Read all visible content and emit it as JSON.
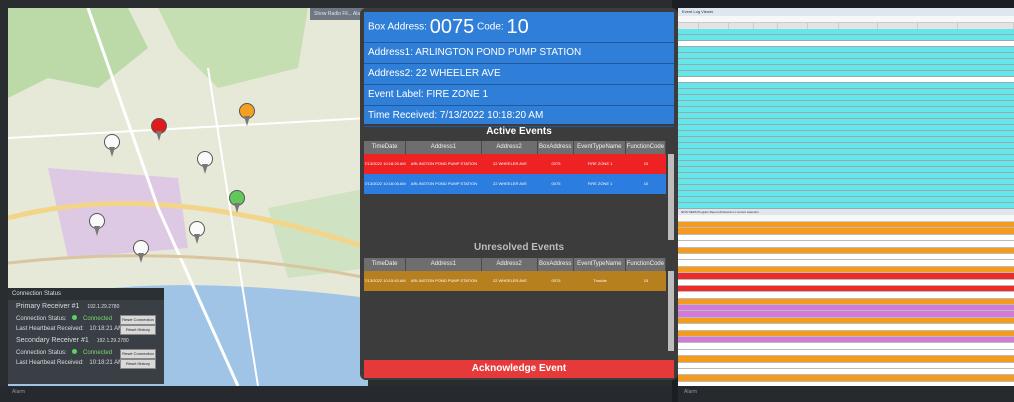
{
  "app": {
    "left_taskbar_label": "Alarm",
    "right_taskbar_label": "Alarm"
  },
  "map": {
    "header": "Show Radio Fil... Alarm"
  },
  "event": {
    "box_address_label": "Box Address:",
    "box_address": "0075",
    "code_label": "Code:",
    "code": "10",
    "address1": "Address1: ARLINGTON POND PUMP STATION",
    "address2": "Address2: 22 WHEELER AVE",
    "event_label": "Event Label: FIRE ZONE 1",
    "time_received": "Time Received: 7/13/2022 10:18:20 AM"
  },
  "active_events": {
    "title": "Active Events",
    "columns": [
      "TimeDate",
      "Address1",
      "Address2",
      "BoxAddress",
      "EventTypeName",
      "FunctionCode"
    ],
    "rows": [
      {
        "cells": [
          "7/13/2022 10:18:20 AM",
          "ARLINGTON POND PUMP STATION",
          "22 WHEELER AVE",
          "0075",
          "FIRE ZONE 1",
          "10"
        ],
        "color": "#ee2222"
      },
      {
        "cells": [
          "7/13/2022 10:16:05 AM",
          "ARLINGTON POND PUMP STATION",
          "22 WHEELER AVE",
          "0075",
          "FIRE ZONE 1",
          "10"
        ],
        "color": "#2b7de0"
      }
    ]
  },
  "unresolved_events": {
    "title": "Unresolved Events",
    "columns": [
      "TimeDate",
      "Address1",
      "Address2",
      "BoxAddress",
      "EventTypeName",
      "FunctionCode"
    ],
    "rows": [
      {
        "cells": [
          "7/13/2022 10:15:40 AM",
          "ARLINGTON POND PUMP STATION",
          "22 WHEELER AVE",
          "0075",
          "Trouble",
          "15"
        ],
        "color": "#b7801e"
      }
    ]
  },
  "ack_button": "Acknowledge Event",
  "connection": {
    "title": "Connection Status",
    "primary_label": "Primary Receiver #1",
    "primary_ip": "192.1.29.2780",
    "secondary_label": "Secondary Receiver #1",
    "secondary_ip": "192.1.29.2780",
    "status_label": "Connection Status:",
    "status_value": "Connected",
    "last_heard_label": "Last Heartbeat Received:",
    "last_heard_value": "10:18:21 AM",
    "btn_reconnect": "Reset Connection",
    "btn_history": "Reset History"
  },
  "right_window": {
    "title": "Event Log Viewer",
    "bottom_title": "NFIS NEPA Program Report All Events Lt current selection"
  },
  "colors": {
    "accent_blue": "#2f7fd9",
    "alarm_red": "#ee2b2b",
    "trouble_orange": "#f49b1e",
    "cyan_row": "#64e6ea"
  }
}
